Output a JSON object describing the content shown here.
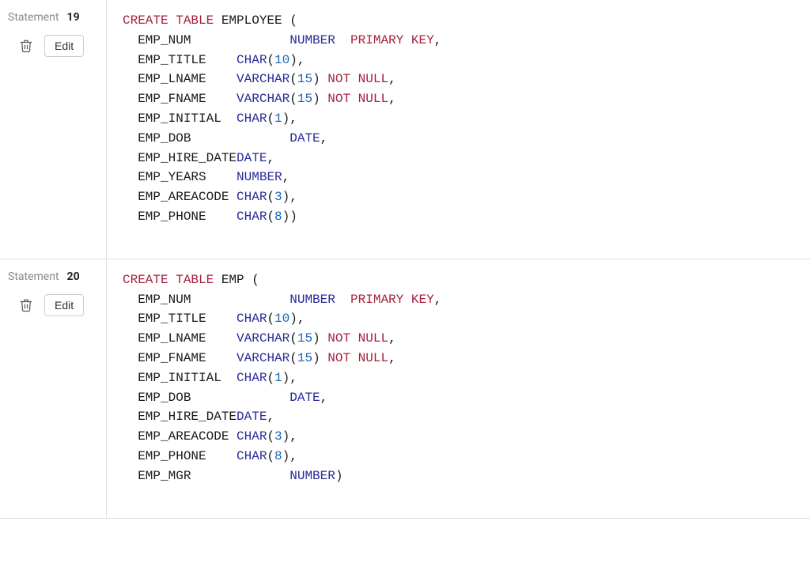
{
  "ui": {
    "statement_label": "Statement",
    "edit_label": "Edit"
  },
  "statements": [
    {
      "number": "19",
      "sql": {
        "stmt": "CREATE TABLE",
        "table": "EMPLOYEE",
        "columns": [
          {
            "name": "EMP_NUM",
            "name_pad": 20,
            "type": "NUMBER",
            "args": null,
            "constraint": "PRIMARY KEY",
            "type_gap": 2
          },
          {
            "name": "EMP_TITLE",
            "name_pad": 13,
            "type": "CHAR",
            "args": [
              "10"
            ],
            "constraint": null
          },
          {
            "name": "EMP_LNAME",
            "name_pad": 13,
            "type": "VARCHAR",
            "args": [
              "15"
            ],
            "constraint": "NOT NULL"
          },
          {
            "name": "EMP_FNAME",
            "name_pad": 13,
            "type": "VARCHAR",
            "args": [
              "15"
            ],
            "constraint": "NOT NULL"
          },
          {
            "name": "EMP_INITIAL",
            "name_pad": 13,
            "type": "CHAR",
            "args": [
              "1"
            ],
            "constraint": null
          },
          {
            "name": "EMP_DOB",
            "name_pad": 20,
            "type": "DATE",
            "args": null,
            "constraint": null
          },
          {
            "name": "EMP_HIRE_DATE",
            "name_pad": 13,
            "type": "DATE",
            "args": null,
            "constraint": null
          },
          {
            "name": "EMP_YEARS",
            "name_pad": 13,
            "type": "NUMBER",
            "args": null,
            "constraint": null
          },
          {
            "name": "EMP_AREACODE",
            "name_pad": 13,
            "type": "CHAR",
            "args": [
              "3"
            ],
            "constraint": null
          },
          {
            "name": "EMP_PHONE",
            "name_pad": 13,
            "type": "CHAR",
            "args": [
              "8"
            ],
            "constraint": null
          }
        ]
      }
    },
    {
      "number": "20",
      "sql": {
        "stmt": "CREATE TABLE",
        "table": "EMP",
        "columns": [
          {
            "name": "EMP_NUM",
            "name_pad": 20,
            "type": "NUMBER",
            "args": null,
            "constraint": "PRIMARY KEY",
            "type_gap": 2
          },
          {
            "name": "EMP_TITLE",
            "name_pad": 13,
            "type": "CHAR",
            "args": [
              "10"
            ],
            "constraint": null
          },
          {
            "name": "EMP_LNAME",
            "name_pad": 13,
            "type": "VARCHAR",
            "args": [
              "15"
            ],
            "constraint": "NOT NULL"
          },
          {
            "name": "EMP_FNAME",
            "name_pad": 13,
            "type": "VARCHAR",
            "args": [
              "15"
            ],
            "constraint": "NOT NULL"
          },
          {
            "name": "EMP_INITIAL",
            "name_pad": 13,
            "type": "CHAR",
            "args": [
              "1"
            ],
            "constraint": null
          },
          {
            "name": "EMP_DOB",
            "name_pad": 20,
            "type": "DATE",
            "args": null,
            "constraint": null
          },
          {
            "name": "EMP_HIRE_DATE",
            "name_pad": 13,
            "type": "DATE",
            "args": null,
            "constraint": null
          },
          {
            "name": "EMP_AREACODE",
            "name_pad": 13,
            "type": "CHAR",
            "args": [
              "3"
            ],
            "constraint": null
          },
          {
            "name": "EMP_PHONE",
            "name_pad": 13,
            "type": "CHAR",
            "args": [
              "8"
            ],
            "constraint": null
          },
          {
            "name": "EMP_MGR",
            "name_pad": 20,
            "type": "NUMBER",
            "args": null,
            "constraint": null
          }
        ]
      }
    }
  ]
}
